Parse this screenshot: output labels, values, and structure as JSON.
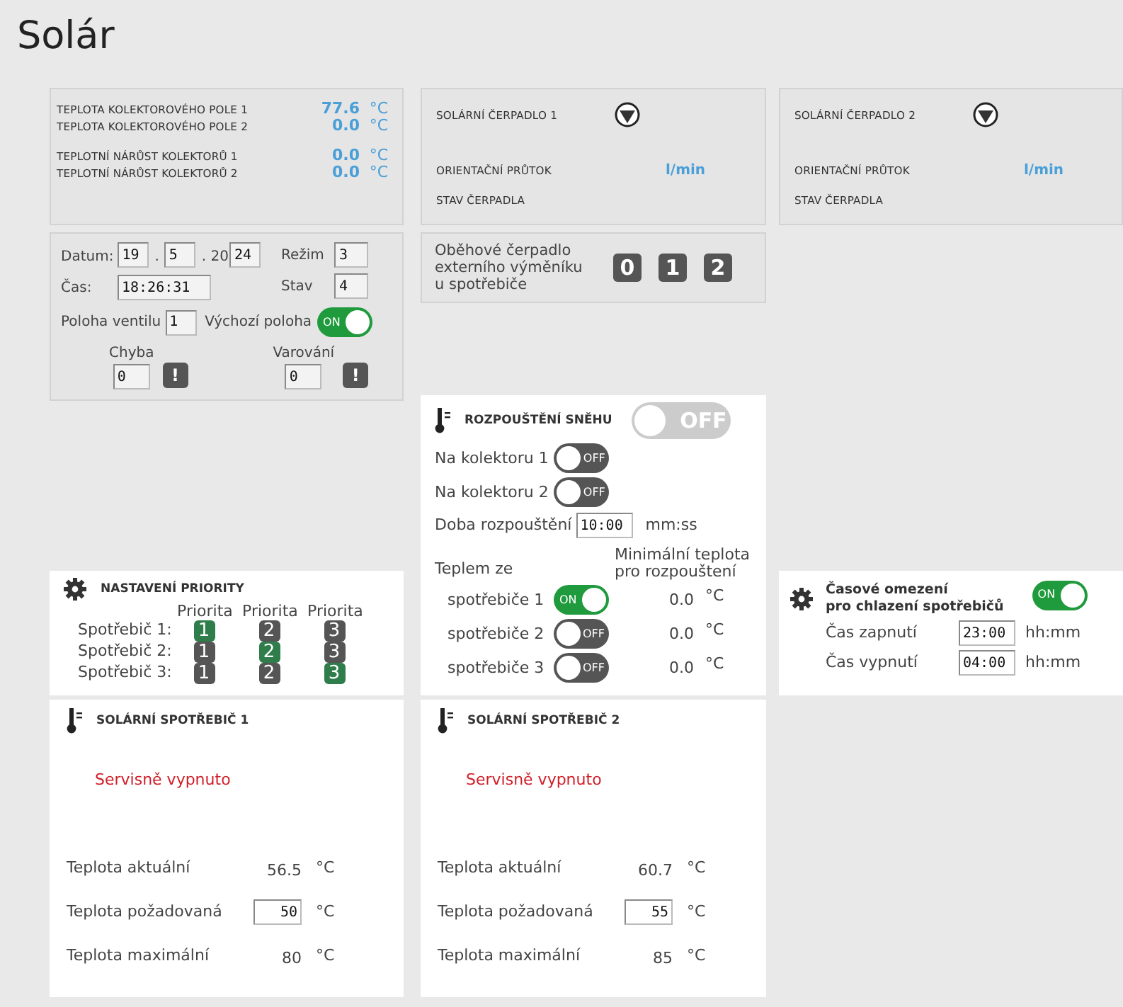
{
  "title": "Solár",
  "collector": {
    "groups": [
      [
        {
          "label": "TEPLOTA KOLEKTOROVÉHO POLE 1",
          "value": "77.6",
          "unit": "°C"
        },
        {
          "label": "TEPLOTA KOLEKTOROVÉHO POLE 2",
          "value": "0.0",
          "unit": "°C"
        }
      ],
      [
        {
          "label": "TEPLOTNÍ NÁRŮST KOLEKTORŮ 1",
          "value": "0.0",
          "unit": "°C"
        },
        {
          "label": "TEPLOTNÍ NÁRŮST KOLEKTORŮ 2",
          "value": "0.0",
          "unit": "°C"
        }
      ]
    ]
  },
  "pumps": [
    {
      "label": "SOLÁRNÍ ČERPADLO 1",
      "flow_label": "ORIENTAČNÍ PRŮTOK",
      "flow_unit": "l/min",
      "state_label": "STAV ČERPADLA"
    },
    {
      "label": "SOLÁRNÍ ČERPADLO 2",
      "flow_label": "ORIENTAČNÍ PRŮTOK",
      "flow_unit": "l/min",
      "state_label": "STAV ČERPADLA"
    }
  ],
  "status": {
    "date_label": "Datum:",
    "day": "19",
    "sep1": ".",
    "month": "5",
    "sep2": ". 20",
    "year": "24",
    "time_label": "Čas:",
    "time": "18:26:31",
    "mode_label": "Režim",
    "mode": "3",
    "state_label": "Stav",
    "state": "4",
    "valve_label": "Poloha ventilu",
    "valve": "1",
    "default_label": "Výchozí poloha",
    "default_toggle": {
      "on": true,
      "text": "ON"
    },
    "error_label": "Chyba",
    "error": "0",
    "error_mark": "!",
    "warning_label": "Varování",
    "warning": "0",
    "warning_mark": "!"
  },
  "circulation": {
    "label_lines": [
      "Oběhové čerpadlo",
      "externího výměníku",
      "u spotřebiče"
    ],
    "buttons": [
      "0",
      "1",
      "2"
    ]
  },
  "snow": {
    "title": "ROZPOUŠTĚNÍ SNĚHU",
    "toggle": {
      "on": false,
      "disabled": true,
      "text": "OFF"
    },
    "collectors": [
      {
        "label": "Na kolektoru 1",
        "toggle": {
          "on": false,
          "text": "OFF"
        }
      },
      {
        "label": "Na kolektoru 2",
        "toggle": {
          "on": false,
          "text": "OFF"
        }
      }
    ],
    "duration_label": "Doba rozpouštění",
    "duration": "10:00",
    "duration_unit": "mm:ss",
    "source_heading": "Teplem ze",
    "min_heading_lines": [
      "Minimální teplota",
      "pro rozpouštení"
    ],
    "sources": [
      {
        "label": "spotřebiče 1",
        "toggle": {
          "on": true,
          "text": "ON"
        },
        "value": "0.0",
        "unit": "°C"
      },
      {
        "label": "spotřebiče 2",
        "toggle": {
          "on": false,
          "text": "OFF"
        },
        "value": "0.0",
        "unit": "°C"
      },
      {
        "label": "spotřebiče 3",
        "toggle": {
          "on": false,
          "text": "OFF"
        },
        "value": "0.0",
        "unit": "°C"
      }
    ]
  },
  "priority": {
    "title": "NASTAVENÍ PRIORITY",
    "column_headers": [
      "Priorita",
      "Priorita",
      "Priorita"
    ],
    "rows": [
      {
        "label": "Spotřebič 1:",
        "cells": [
          {
            "text": "1",
            "selected": true
          },
          {
            "text": "2",
            "selected": false
          },
          {
            "text": "3",
            "selected": false
          }
        ]
      },
      {
        "label": "Spotřebič 2:",
        "cells": [
          {
            "text": "1",
            "selected": false
          },
          {
            "text": "2",
            "selected": true
          },
          {
            "text": "3",
            "selected": false
          }
        ]
      },
      {
        "label": "Spotřebič 3:",
        "cells": [
          {
            "text": "1",
            "selected": false
          },
          {
            "text": "2",
            "selected": false
          },
          {
            "text": "3",
            "selected": true
          }
        ]
      }
    ]
  },
  "cooling": {
    "title_lines": [
      "Časové omezení",
      "pro chlazení spotřebičů"
    ],
    "toggle": {
      "on": true,
      "text": "ON"
    },
    "rows": [
      {
        "label": "Čas zapnutí",
        "value": "23:00",
        "unit": "hh:mm"
      },
      {
        "label": "Čas vypnutí",
        "value": "04:00",
        "unit": "hh:mm"
      }
    ]
  },
  "consumers": [
    {
      "title": "SOLÁRNÍ SPOTŘEBIČ 1",
      "status": "Servisně vypnuto",
      "rows": [
        {
          "kind": "readout",
          "label": "Teplota aktuální",
          "value": "56.5",
          "unit": "°C"
        },
        {
          "kind": "input",
          "label": "Teplota požadovaná",
          "value": "50",
          "unit": "°C"
        },
        {
          "kind": "readout",
          "label": "Teplota maximální",
          "value": "80",
          "unit": "°C"
        }
      ]
    },
    {
      "title": "SOLÁRNÍ SPOTŘEBIČ 2",
      "status": "Servisně vypnuto",
      "rows": [
        {
          "kind": "readout",
          "label": "Teplota aktuální",
          "value": "60.7",
          "unit": "°C"
        },
        {
          "kind": "input",
          "label": "Teplota požadovaná",
          "value": "55",
          "unit": "°C"
        },
        {
          "kind": "readout",
          "label": "Teplota maximální",
          "value": "85",
          "unit": "°C"
        }
      ]
    }
  ]
}
